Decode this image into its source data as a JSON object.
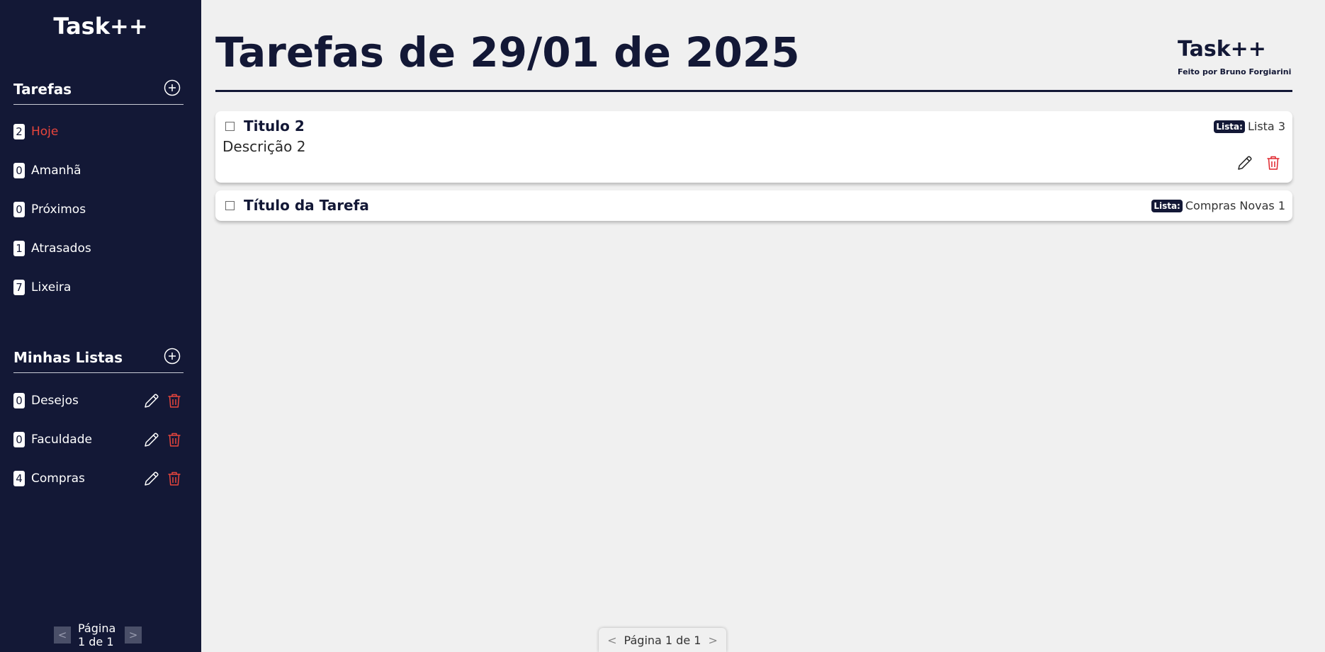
{
  "sidebar": {
    "brand": "Task++",
    "tasks_section": {
      "title": "Tarefas",
      "items": [
        {
          "count": "2",
          "label": "Hoje",
          "active": true
        },
        {
          "count": "0",
          "label": "Amanhã"
        },
        {
          "count": "0",
          "label": "Próximos"
        },
        {
          "count": "1",
          "label": "Atrasados"
        },
        {
          "count": "7",
          "label": "Lixeira"
        }
      ]
    },
    "lists_section": {
      "title": "Minhas Listas",
      "items": [
        {
          "count": "0",
          "label": "Desejos"
        },
        {
          "count": "0",
          "label": "Faculdade"
        },
        {
          "count": "4",
          "label": "Compras"
        }
      ]
    },
    "pager": {
      "prev": "<",
      "text": "Página 1 de 1",
      "next": ">"
    }
  },
  "header": {
    "title": "Tarefas de 29/01 de 2025",
    "brand": "Task++",
    "credit": "Feito por Bruno Forgiarini"
  },
  "tasks": [
    {
      "title": "Titulo 2",
      "description": "Descrição 2",
      "list_tag": "Lista:",
      "list_name": "Lista 3"
    },
    {
      "title": "Título da Tarefa",
      "list_tag": "Lista:",
      "list_name": "Compras Novas 1"
    }
  ],
  "main_pager": {
    "prev": "<",
    "text": "Página 1 de 1",
    "next": ">"
  },
  "colors": {
    "sidebar_bg": "#131836",
    "accent_red": "#e8453c",
    "main_bg": "#f0f0f0"
  },
  "icons": {
    "add": "plus-circle-icon",
    "edit": "pencil-icon",
    "delete": "trash-icon"
  }
}
